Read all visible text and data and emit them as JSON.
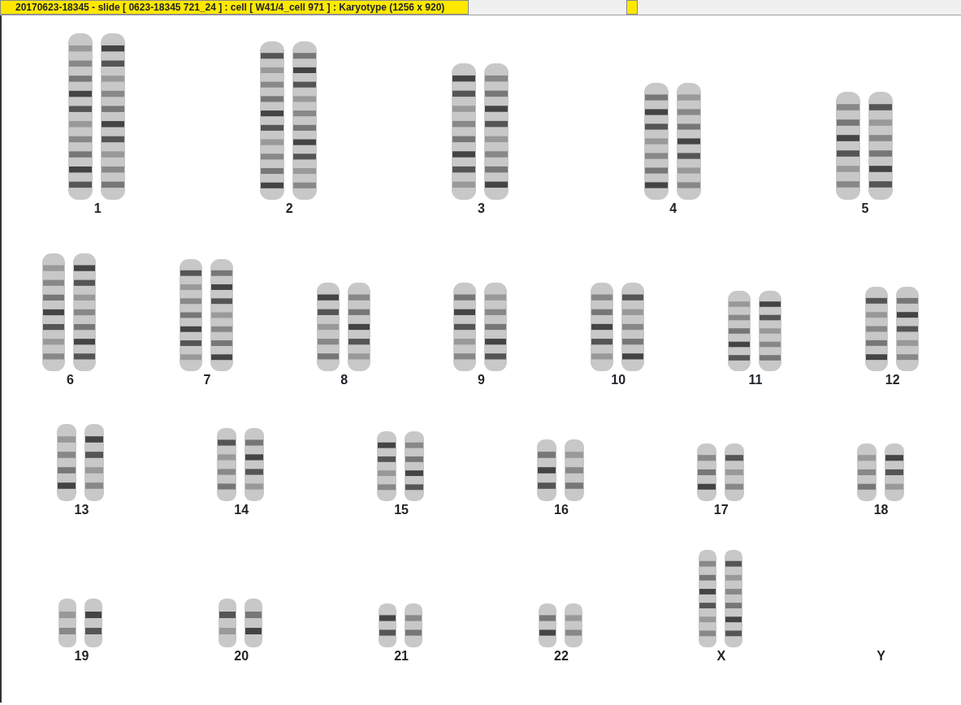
{
  "window": {
    "title": "20170623-18345 - slide [ 0623-18345 721_24 ] : cell [ W41/4_cell 971 ] : Karyotype  (1256 x 920)"
  },
  "rows": [
    {
      "pairs": [
        {
          "label": "1",
          "kind": "pair"
        },
        {
          "label": "2",
          "kind": "pair"
        },
        {
          "label": "3",
          "kind": "pair"
        },
        {
          "label": "4",
          "kind": "pair"
        },
        {
          "label": "5",
          "kind": "pair"
        }
      ]
    },
    {
      "pairs": [
        {
          "label": "6",
          "kind": "pair"
        },
        {
          "label": "7",
          "kind": "pair"
        },
        {
          "label": "8",
          "kind": "pair"
        },
        {
          "label": "9",
          "kind": "pair"
        },
        {
          "label": "10",
          "kind": "pair"
        },
        {
          "label": "11",
          "kind": "pair"
        },
        {
          "label": "12",
          "kind": "pair"
        }
      ]
    },
    {
      "pairs": [
        {
          "label": "13",
          "kind": "pair"
        },
        {
          "label": "14",
          "kind": "pair"
        },
        {
          "label": "15",
          "kind": "pair"
        },
        {
          "label": "16",
          "kind": "pair"
        },
        {
          "label": "17",
          "kind": "pair"
        },
        {
          "label": "18",
          "kind": "pair"
        }
      ]
    },
    {
      "pairs": [
        {
          "label": "19",
          "kind": "pair"
        },
        {
          "label": "20",
          "kind": "pair"
        },
        {
          "label": "21",
          "kind": "pair"
        },
        {
          "label": "22",
          "kind": "pair"
        },
        {
          "label": "X",
          "kind": "pair"
        },
        {
          "label": "Y",
          "kind": "none"
        }
      ]
    }
  ]
}
